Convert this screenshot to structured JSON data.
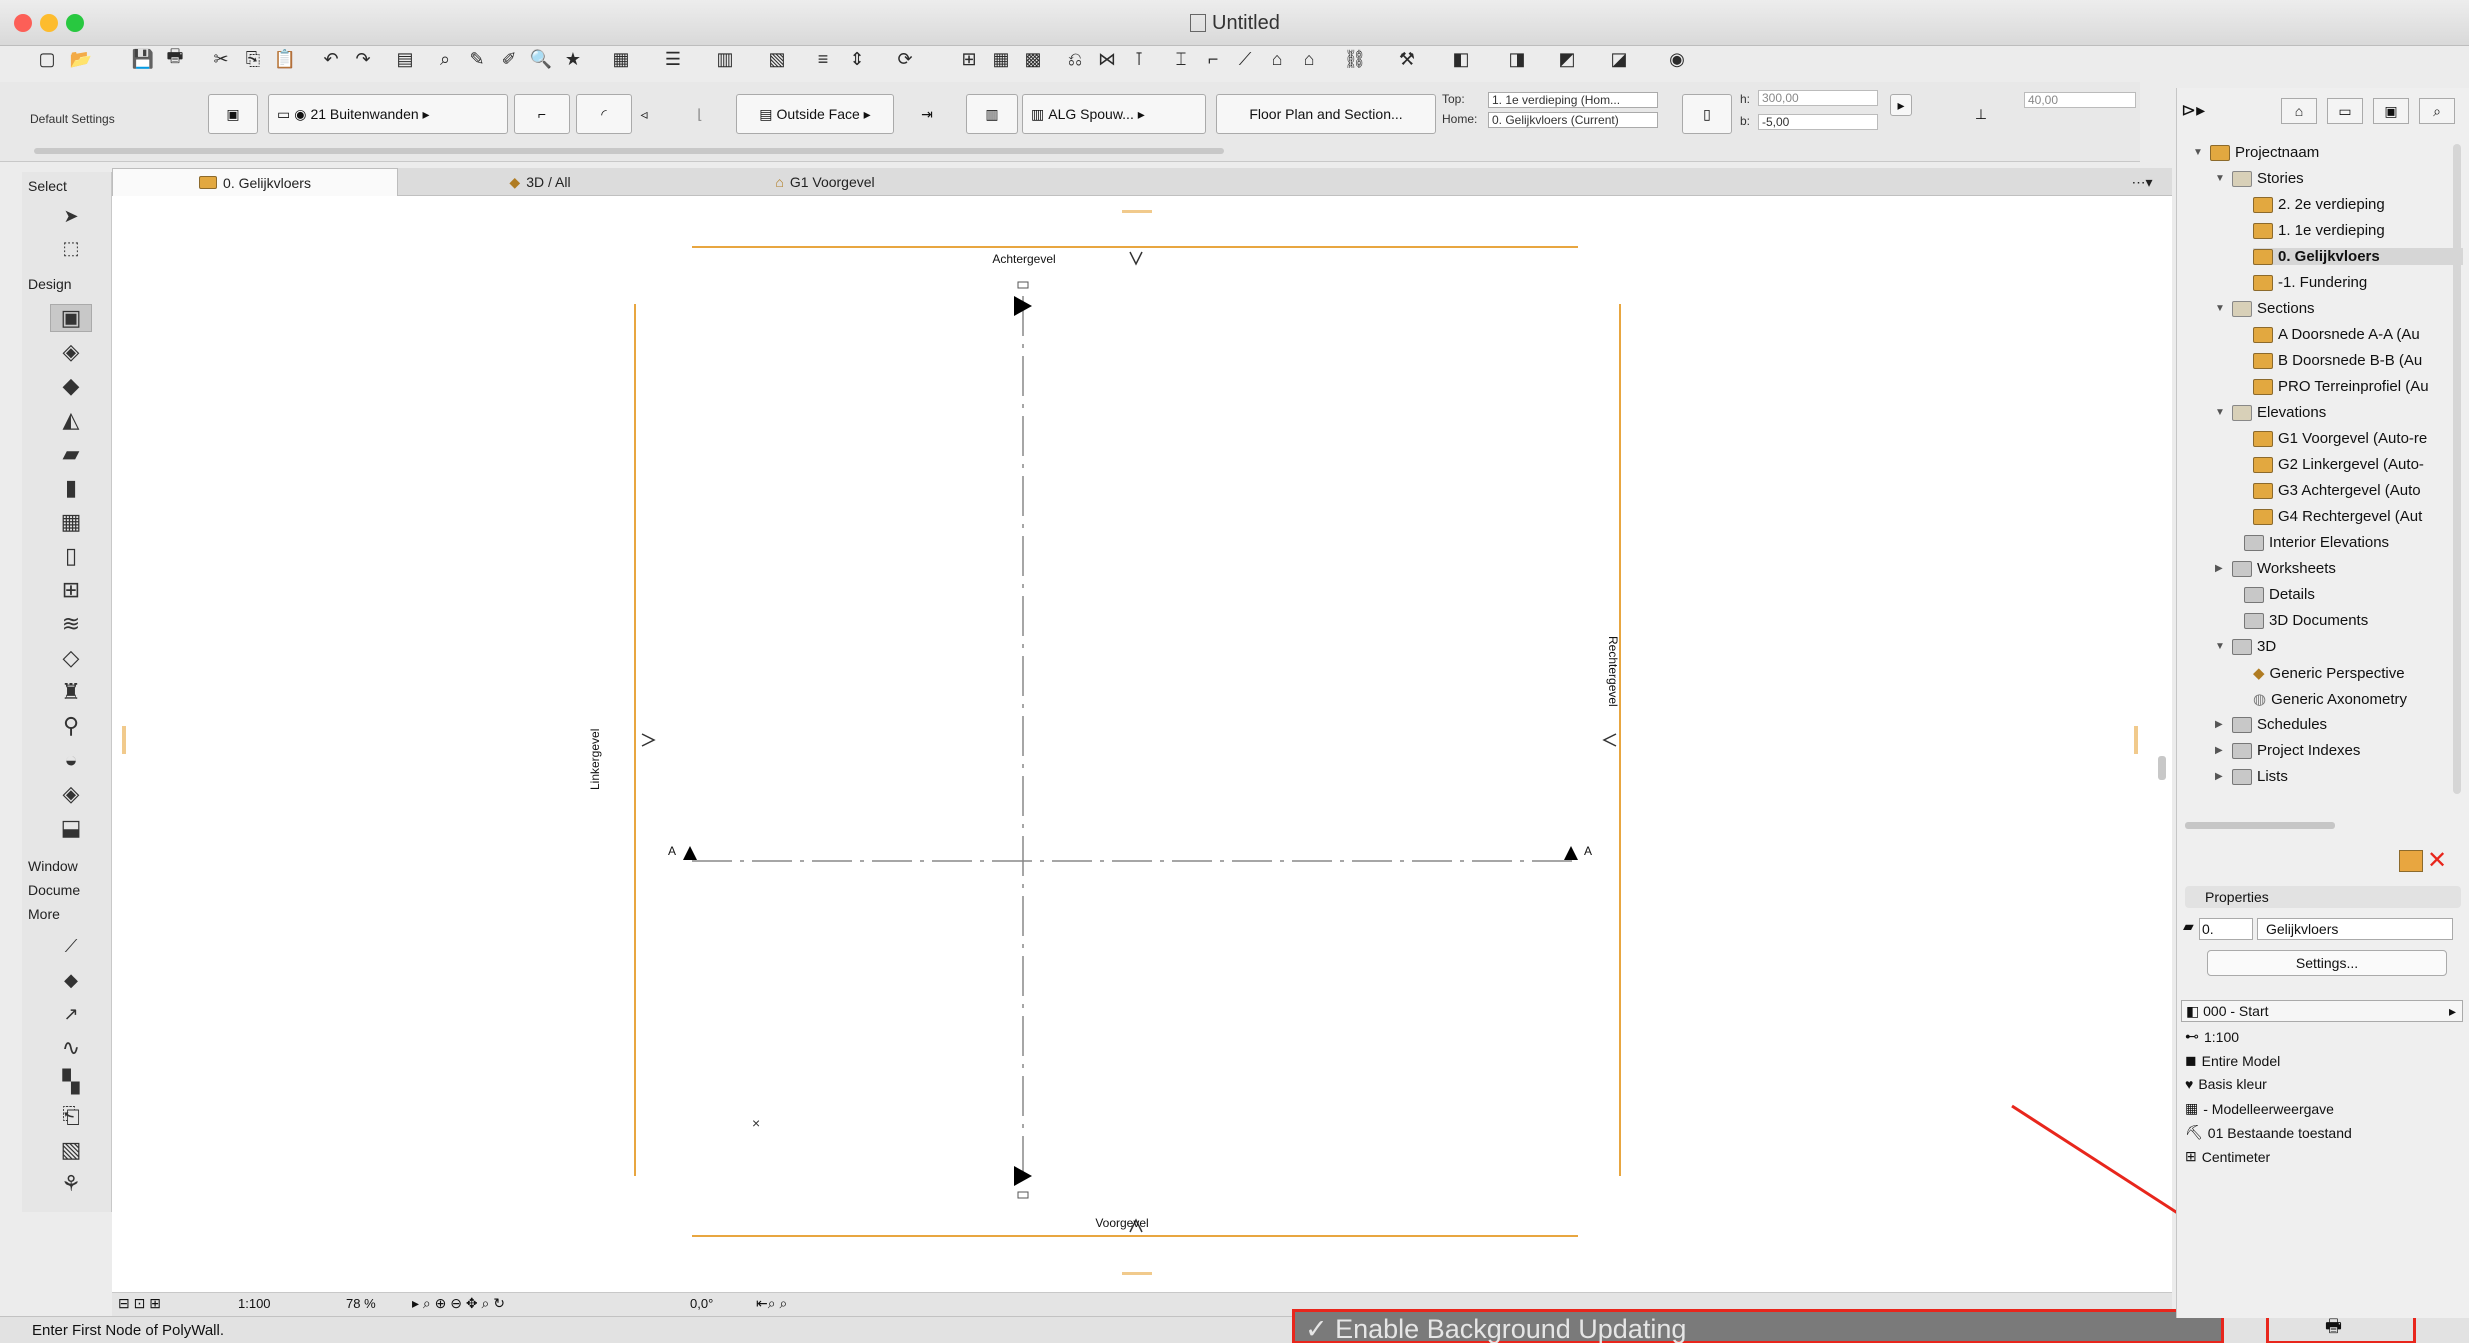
{
  "window": {
    "title": "Untitled"
  },
  "infobox": {
    "default_settings": "Default Settings",
    "layer": "21 Buitenwanden",
    "reference_line": "Outside Face",
    "composite": "ALG Spouw...",
    "structure_display": "Floor Plan and Section...",
    "top_label": "Top:",
    "top_value": "1. 1e verdieping (Hom...",
    "home_label": "Home:",
    "home_value": "0. Gelijkvloers (Current)",
    "h_label": "h:",
    "h_value": "300,00",
    "b_label": "b:",
    "b_value": "-5,00",
    "thickness_value": "40,00"
  },
  "toolbox": {
    "select_header": "Select",
    "design_header": "Design",
    "window_header": "Window",
    "document_header": "Docume",
    "more_header": "More"
  },
  "tabs": [
    {
      "label": "0. Gelijkvloers"
    },
    {
      "label": "3D / All"
    },
    {
      "label": "G1 Voorgevel"
    }
  ],
  "plan": {
    "north_marker": "Achtergevel",
    "south_marker": "Voorgevel",
    "west_marker": "Linkergevel",
    "east_marker": "Rechtergevel",
    "section_left": "A",
    "section_right": "A"
  },
  "bottombar": {
    "scale": "1:100",
    "zoom": "78 %",
    "angle": "0,0°"
  },
  "status": {
    "message": "Enter First Node of PolyWall.",
    "popup": "✓ Enable Background Updating"
  },
  "navigator": {
    "root": "Projectnaam",
    "stories": "Stories",
    "story_2": "2. 2e verdieping",
    "story_1": "1. 1e verdieping",
    "story_0": "0. Gelijkvloers",
    "story_m1": "-1. Fundering",
    "sections": "Sections",
    "section_a": "A Doorsnede A-A (Au",
    "section_b": "B Doorsnede B-B (Au",
    "section_pro": "PRO Terreinprofiel (Au",
    "elevations": "Elevations",
    "elev_g1": "G1 Voorgevel (Auto-re",
    "elev_g2": "G2 Linkergevel (Auto-",
    "elev_g3": "G3 Achtergevel (Auto",
    "elev_g4": "G4 Rechtergevel (Aut",
    "interior": "Interior Elevations",
    "worksheets": "Worksheets",
    "details": "Details",
    "docs3d": "3D Documents",
    "three_d": "3D",
    "perspective": "Generic Perspective",
    "axonometry": "Generic Axonometry",
    "schedules": "Schedules",
    "indexes": "Project Indexes",
    "lists": "Lists",
    "properties_header": "Properties",
    "prop_number": "0.",
    "prop_name": "Gelijkvloers",
    "settings_button": "Settings...",
    "view_set": "000 - Start",
    "view_scale": "1:100",
    "view_model": "Entire Model",
    "view_pen": "Basis kleur",
    "view_model_view": "- Modelleerweergave",
    "view_reno": "01 Bestaande toestand",
    "view_units": "Centimeter"
  },
  "colors": {
    "accent_orange": "#e8a640",
    "annotation_red": "#e8261c",
    "popup_bg": "#7a7a7a"
  }
}
